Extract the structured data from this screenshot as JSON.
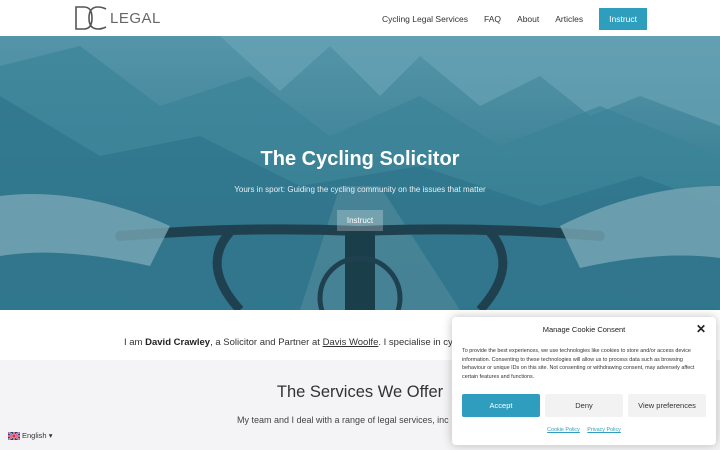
{
  "header": {
    "logo_text": "LEGAL",
    "nav": [
      {
        "label": "Cycling Legal Services"
      },
      {
        "label": "FAQ"
      },
      {
        "label": "About"
      },
      {
        "label": "Articles"
      }
    ],
    "cta_label": "Instruct"
  },
  "hero": {
    "title": "The Cycling Solicitor",
    "subtitle": "Yours in sport: Guiding the cycling community on the issues that matter",
    "button_label": "Instruct"
  },
  "intro": {
    "prefix": "I am ",
    "name": "David Crawley",
    "middle": ", a Solicitor and Partner at ",
    "firm_link": "Davis Woolfe",
    "suffix": ".  I specialise in cycle"
  },
  "services": {
    "title": "The Services We Offer",
    "description": "My team and I deal with a range of legal services, inc"
  },
  "language": {
    "label": "English",
    "caret": "▾"
  },
  "cookie": {
    "title": "Manage Cookie Consent",
    "close": "✕",
    "body": "To provide the best experiences, we use technologies like cookies to store and/or access device information. Consenting to these technologies will allow us to process data such as browsing behaviour or unique IDs on this site. Not consenting or withdrawing consent, may adversely affect certain features and functions.",
    "accept": "Accept",
    "deny": "Deny",
    "preferences": "View preferences",
    "cookie_policy": "Cookie Policy",
    "privacy_policy": "Privacy Policy"
  },
  "colors": {
    "accent": "#2f9dbd",
    "hero_tint": "#3a7b90"
  }
}
